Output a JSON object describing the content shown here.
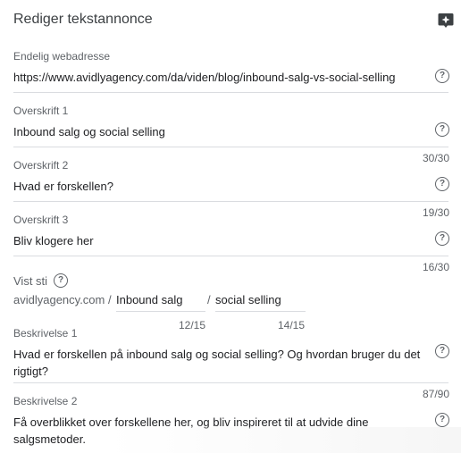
{
  "header": {
    "title": "Rediger tekstannonce",
    "assistant_icon": "sparkle-chat-icon"
  },
  "final_url": {
    "label": "Endelig webadresse",
    "value": "https://www.avidlyagency.com/da/viden/blog/inbound-salg-vs-social-selling"
  },
  "headline1": {
    "label": "Overskrift 1",
    "value": "Inbound salg og social selling",
    "counter": "30/30"
  },
  "headline2": {
    "label": "Overskrift 2",
    "value": "Hvad er forskellen?",
    "counter": "19/30"
  },
  "headline3": {
    "label": "Overskrift 3",
    "value": "Bliv klogere her",
    "counter": "16/30"
  },
  "display_path": {
    "label": "Vist sti",
    "domain": "avidlyagency.com /",
    "path1": "Inbound salg",
    "separator": "/",
    "path2": "social selling",
    "counter1": "12/15",
    "counter2": "14/15"
  },
  "description1": {
    "label": "Beskrivelse 1",
    "line1": "Hvad er forskellen på inbound salg og social selling? Og hvordan bruger du det",
    "line2": "rigtigt?",
    "counter": "87/90"
  },
  "description2": {
    "label": "Beskrivelse 2",
    "line1": "Få overblikket over forskellene her, og bliv inspireret til at udvide dine",
    "line2": "salgsmetoder."
  },
  "help_glyph": "?"
}
